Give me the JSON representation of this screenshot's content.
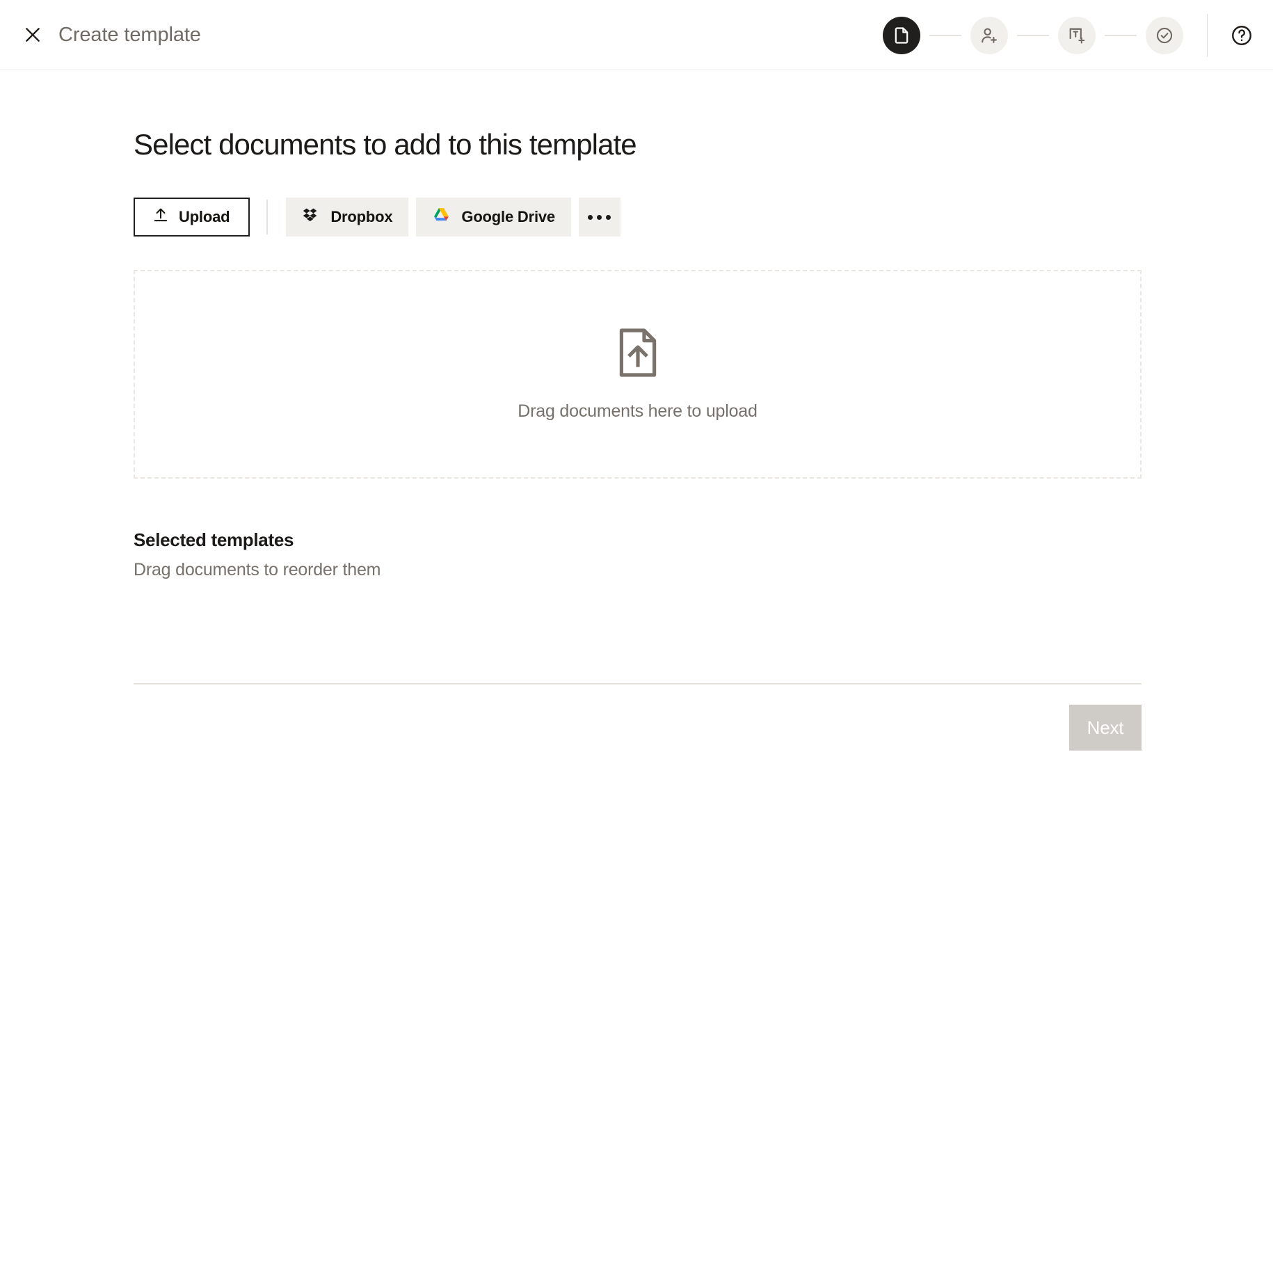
{
  "header": {
    "close_icon": "close-icon",
    "title": "Create template",
    "help_icon": "help-circle-icon",
    "steps": [
      {
        "id": "document",
        "icon": "document-icon",
        "active": true
      },
      {
        "id": "recipients",
        "icon": "add-person-icon",
        "active": false
      },
      {
        "id": "fields",
        "icon": "add-text-field-icon",
        "active": false
      },
      {
        "id": "review",
        "icon": "check-circle-icon",
        "active": false
      }
    ]
  },
  "main": {
    "page_title": "Select documents to add to this template",
    "sources": {
      "upload_label": "Upload",
      "upload_icon": "upload-arrow-icon",
      "dropbox_label": "Dropbox",
      "dropbox_icon": "dropbox-icon",
      "google_drive_label": "Google Drive",
      "google_drive_icon": "google-drive-icon",
      "more_label": "More options",
      "more_icon": "ellipsis-icon"
    },
    "dropzone": {
      "icon": "document-upload-icon",
      "text": "Drag documents here to upload"
    },
    "selected": {
      "title": "Selected templates",
      "subtitle": "Drag documents to reorder them",
      "items": []
    },
    "footer": {
      "next_label": "Next",
      "next_disabled": true
    }
  },
  "colors": {
    "accent_dark": "#211f1d",
    "step_inactive_bg": "#f2f0ec",
    "source_btn_bg": "#f1efeb",
    "dashed_border": "#e9e6e1",
    "muted_text": "#77716b",
    "next_disabled_bg": "#cfcbc6",
    "gdrive_green": "#00A45E",
    "gdrive_yellow": "#FFC107",
    "gdrive_blue": "#4285F4",
    "gdrive_red": "#EA4335",
    "dropbox_blue": "#1c1a18"
  }
}
